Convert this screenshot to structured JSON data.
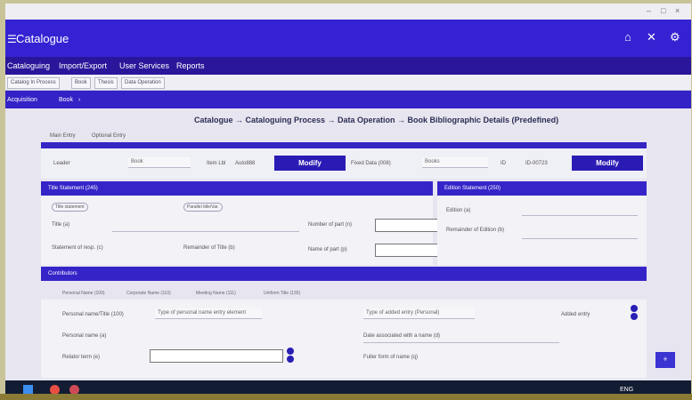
{
  "window": {
    "title": "",
    "controls": [
      "–",
      "□",
      "×"
    ]
  },
  "appbar": {
    "menu_icon": "menu-icon",
    "title": "Catalogue",
    "icons": [
      "home-icon",
      "close-icon",
      "settings-icon"
    ]
  },
  "menu": {
    "items": [
      "Cataloguing",
      "Import/Export",
      "User Services",
      "Reports"
    ]
  },
  "tabs": [
    "Catalog In Process",
    "Book",
    "Thesis",
    "Data Operation"
  ],
  "crumb": {
    "items": [
      "Acquisition",
      "Book",
      "›"
    ]
  },
  "page": {
    "title": "Catalogue → Cataloguing Process → Data Operation → Book Bibliographic Details (Predefined)"
  },
  "subtabs": [
    "Main Entry",
    "Optional Entry"
  ],
  "row1": {
    "left_label": "Leader",
    "left_select": "Book",
    "left_extra_label": "Item Lbl",
    "left_extra_value": "Auto888",
    "modify_label": "Modify",
    "right_label": "Fixed Data (008)",
    "right_select": "Books",
    "right_extra_label": "ID",
    "right_extra_value": "ID-00723",
    "modify2_label": "Modify"
  },
  "section_title": {
    "left": "Title Statement (245)",
    "right": "Edition Statement (250)"
  },
  "fields": {
    "pill1": "Title statement",
    "pill2": "Parallel title/Var.",
    "title_label": "Title (a)",
    "remainder_label": "Remainder of Title (b)",
    "statement_label": "Statement of resp. (c)",
    "number_label": "Number of part (n)",
    "name_label": "Name of part (p)",
    "edition_label": "Edition (a)",
    "remainder_edition_label": "Remainder of Edition (b)"
  },
  "section2_title": "Contributors",
  "inner_tabs": [
    "Personal Name (100)",
    "Corporate Name (110)",
    "Meeting Name (111)",
    "Uniform Title (130)"
  ],
  "contributors": {
    "row1_label": "Personal name/Title (100)",
    "row1_select": "Type of personal name entry element",
    "row1_right_select": "Type of added entry (Personal)",
    "row1_checkbox": "Added entry",
    "row2_label": "Personal name (a)",
    "row2_right": "Date associated with a name (d)",
    "row3_label": "Relator term (e)",
    "row3_right": "Fuller form of name (q)"
  },
  "fab": "+",
  "taskbar": {
    "tray": "ENG"
  },
  "colors": {
    "appbar": "#3523d3",
    "menubar": "#2a169a",
    "button": "#2b1bb5"
  }
}
